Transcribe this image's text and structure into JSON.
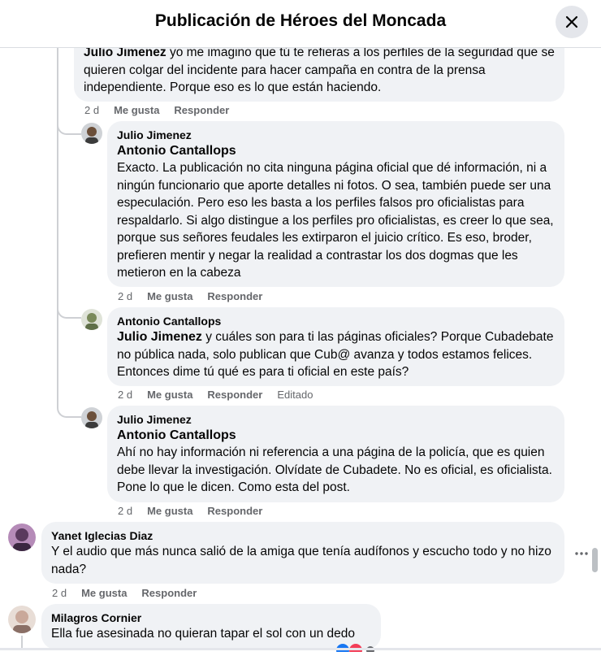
{
  "header": {
    "title": "Publicación de Héroes del Moncada"
  },
  "comments": [
    {
      "mention": "Julio Jimenez",
      "text": " yo me imagino que tú te refieras a los perfiles de la seguridad que se quieren colgar del incidente para hacer campaña en contra de la prensa independiente. Porque eso es lo que están haciendo.",
      "time": "2 d",
      "like": "Me gusta",
      "reply": "Responder"
    },
    {
      "author": "Julio Jimenez",
      "mention": "Antonio Cantallops",
      "text": "Exacto. La publicación no cita ninguna página oficial que dé información, ni a ningún funcionario que aporte detalles ni fotos. O sea, también puede ser una especulación. Pero eso les basta a los perfiles falsos pro oficialistas para respaldarlo. Si algo distingue a los perfiles pro oficialistas, es creer lo que sea, porque sus señores feudales les extirparon el juicio crítico. Es eso, broder, prefieren mentir y negar la realidad a contrastar los dos dogmas que les metieron en la cabeza",
      "time": "2 d",
      "like": "Me gusta",
      "reply": "Responder"
    },
    {
      "author": "Antonio Cantallops",
      "mention": "Julio Jimenez",
      "text": " y cuáles son para ti las páginas oficiales? Porque Cubadebate no pública nada, solo publican que Cub@ avanza y todos estamos felices. Entonces dime tú qué es para ti oficial en este país?",
      "time": "2 d",
      "like": "Me gusta",
      "reply": "Responder",
      "edited": "Editado"
    },
    {
      "author": "Julio Jimenez",
      "mention": "Antonio Cantallops",
      "text": "Ahí no hay información ni referencia a una página de la policía, que es quien debe llevar la investigación. Olvídate de Cubadete. No es oficial, es oficialista. Pone lo que le dicen. Como esta del post.",
      "time": "2 d",
      "like": "Me gusta",
      "reply": "Responder"
    },
    {
      "author": "Yanet Iglecias Diaz",
      "text": "Y el audio que más nunca salió de la amiga que tenía audífonos y escucho todo y no hizo nada?",
      "time": "2 d",
      "like": "Me gusta",
      "reply": "Responder"
    },
    {
      "author": "Milagros Cornier",
      "text": "Ella fue asesinada no quieran tapar el sol con un dedo"
    }
  ],
  "icons": {
    "close": "close-icon",
    "more": "more-options-icon",
    "avatar_colors": [
      "#6b4f3a",
      "#7a8a5a",
      "#5a3a5e",
      "#c9a89a"
    ]
  }
}
